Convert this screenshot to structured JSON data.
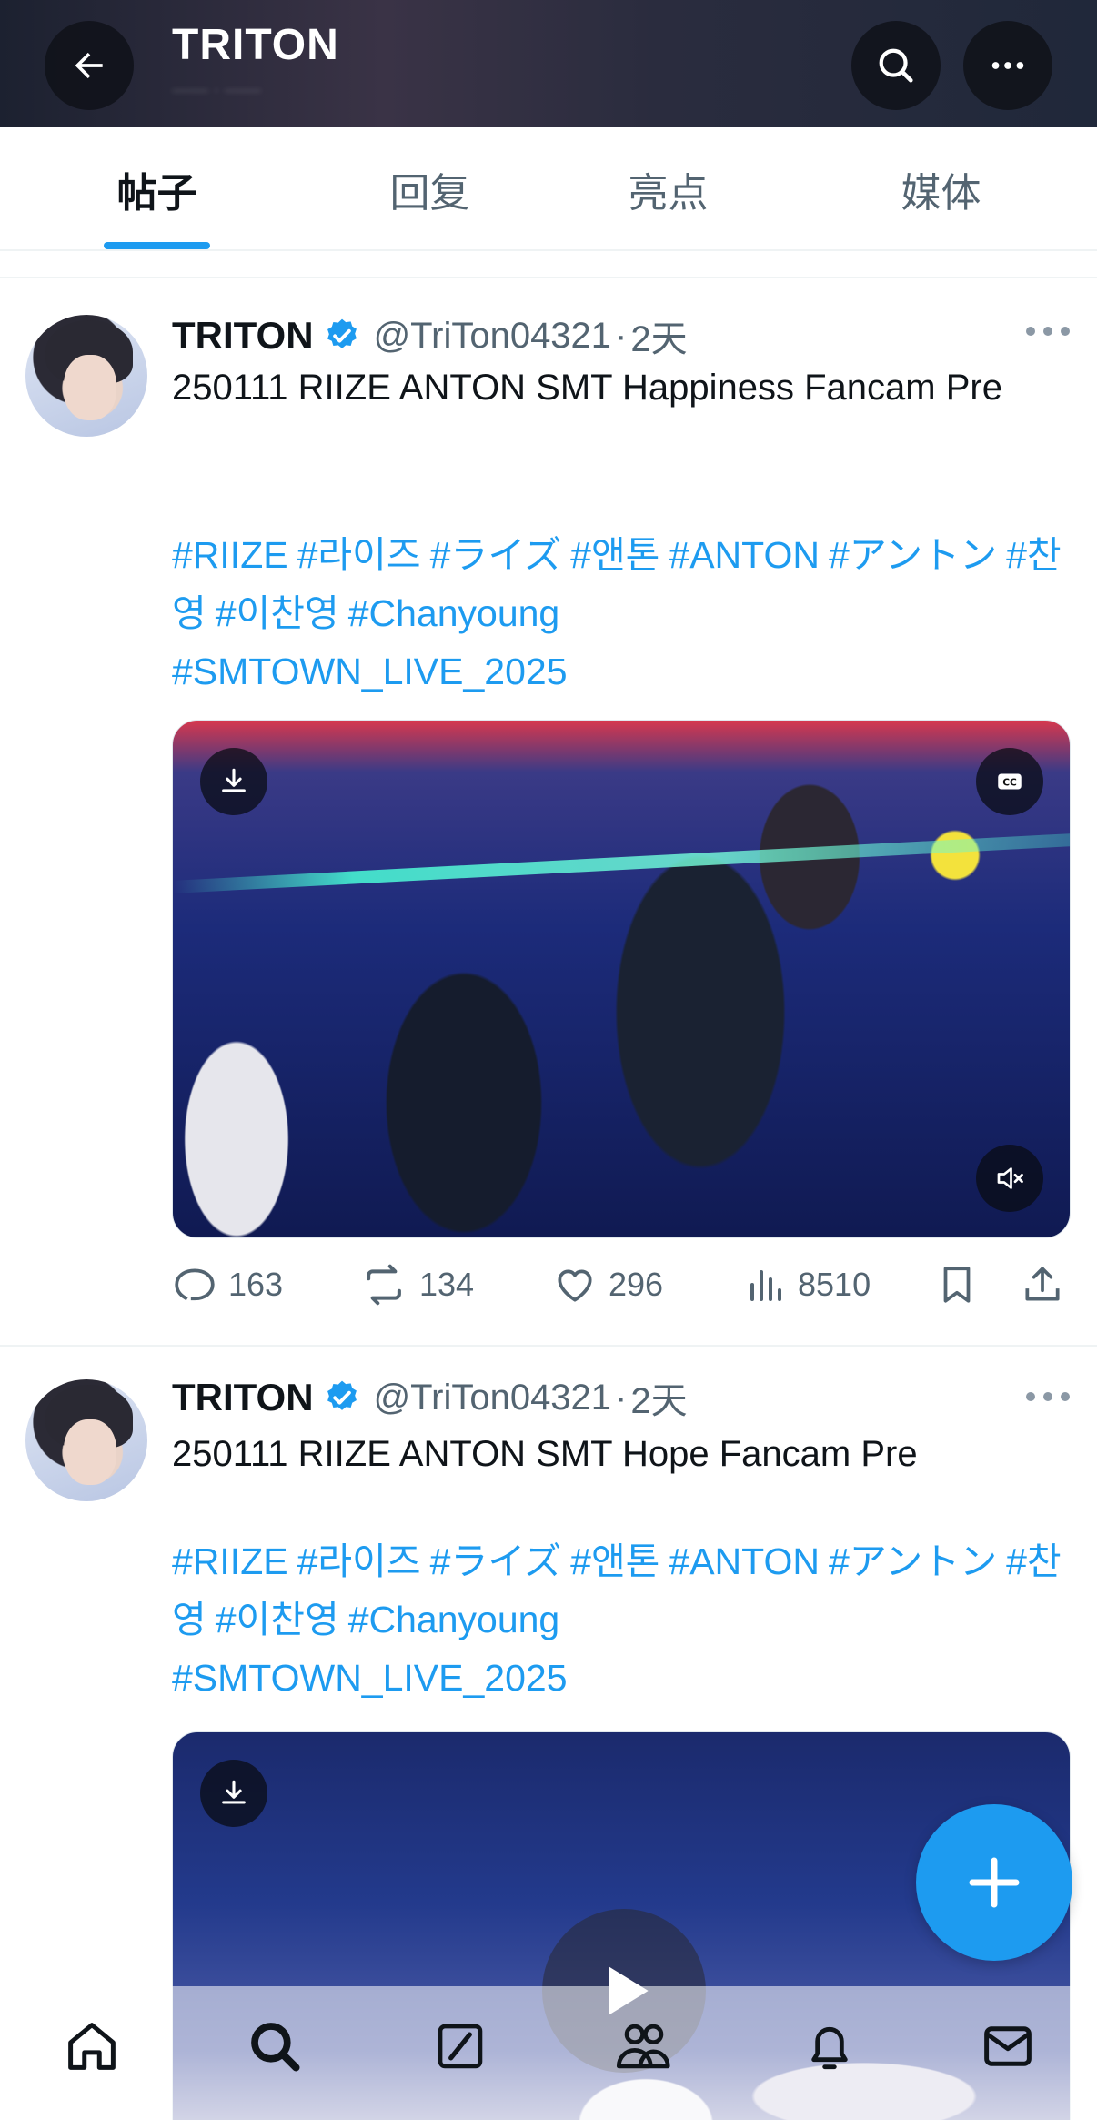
{
  "header": {
    "title": "TRITON",
    "subtitle": "—— · ——"
  },
  "tabs": [
    {
      "label": "帖子",
      "active": true
    },
    {
      "label": "回复",
      "active": false
    },
    {
      "label": "亮点",
      "active": false
    },
    {
      "label": "媒体",
      "active": false
    }
  ],
  "posts": [
    {
      "author": "TRITON",
      "handle": "@TriTon04321",
      "dot": "·",
      "time": "2天",
      "text": "250111 RIIZE ANTON SMT Happiness Fancam Pre",
      "hashtags": [
        "#RIIZE",
        "#라이즈",
        "#ライズ",
        "#앤톤",
        "#ANTON",
        "#アントン",
        "#찬영",
        "#이찬영",
        "#Chanyoung",
        "#SMTOWN_LIVE_2025"
      ],
      "replies": "163",
      "reposts": "134",
      "likes": "296",
      "views": "8510"
    },
    {
      "author": "TRITON",
      "handle": "@TriTon04321",
      "dot": "·",
      "time": "2天",
      "text": "250111 RIIZE ANTON SMT Hope Fancam Pre",
      "hashtags": [
        "#RIIZE",
        "#라이즈",
        "#ライズ",
        "#앤톤",
        "#ANTON",
        "#アントン",
        "#찬영",
        "#이찬영",
        "#Chanyoung",
        "#SMTOWN_LIVE_2025"
      ]
    }
  ],
  "icons": {
    "back": "arrow-left-icon",
    "search": "search-icon",
    "more": "more-horizontal-icon",
    "verified": "verified-badge-icon",
    "download": "download-icon",
    "captions": "cc-icon",
    "mute": "mute-icon",
    "reply": "reply-icon",
    "repost": "repost-icon",
    "like": "heart-icon",
    "views": "views-icon",
    "bookmark": "bookmark-icon",
    "share": "share-icon",
    "compose": "plus-icon",
    "play": "play-icon",
    "nav": [
      "home-icon",
      "search-icon",
      "grok-icon",
      "communities-icon",
      "notifications-icon",
      "messages-icon"
    ]
  },
  "colors": {
    "accent": "#1d9bf0",
    "text": "#0f1419",
    "secondary": "#536471"
  }
}
